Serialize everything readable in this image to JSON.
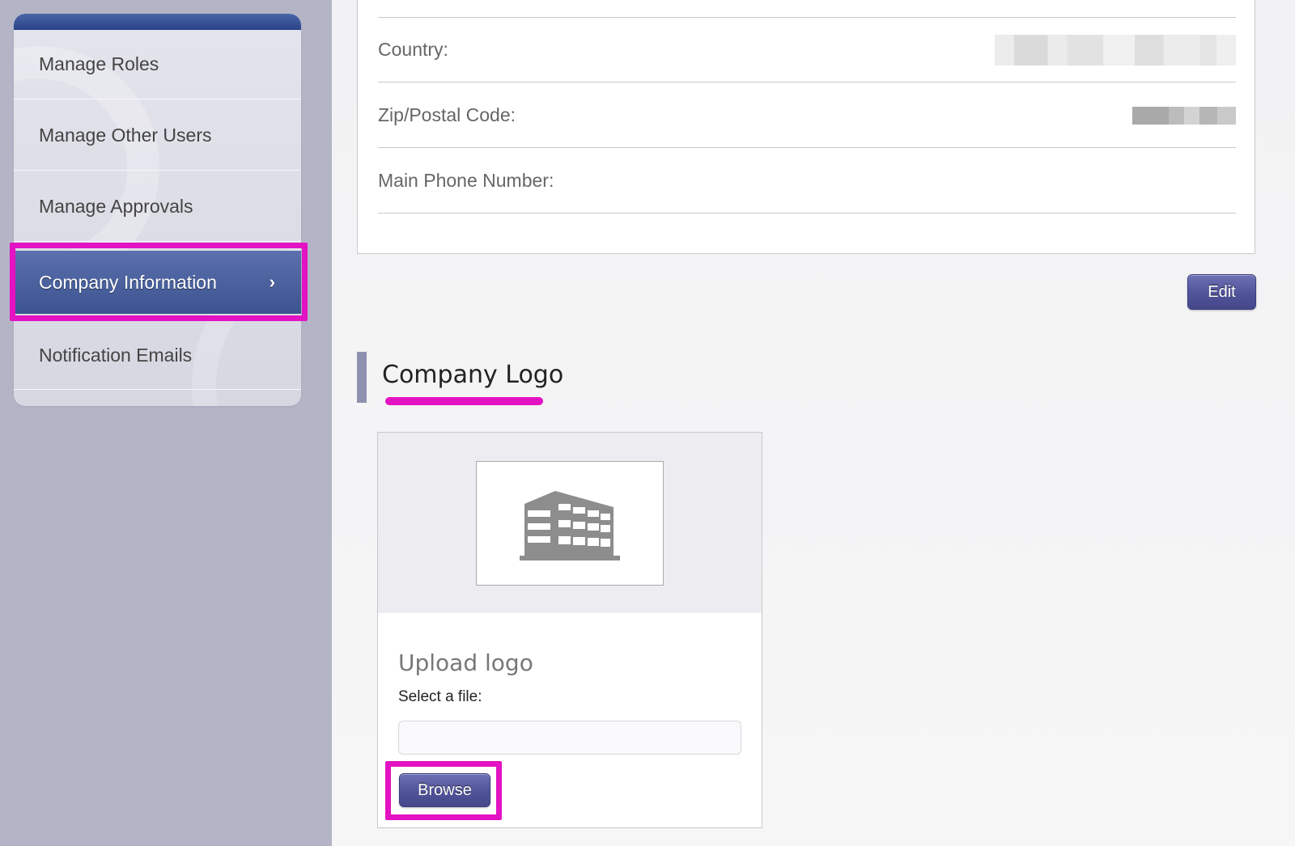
{
  "sidebar": {
    "items": [
      {
        "label": "Manage Roles"
      },
      {
        "label": "Manage Other Users"
      },
      {
        "label": "Manage Approvals"
      },
      {
        "label": "Company Information",
        "active": true
      },
      {
        "label": "Notification Emails"
      }
    ],
    "active_chevron": "›"
  },
  "company_info": {
    "rows": [
      {
        "label": "Country:",
        "value_redacted": true
      },
      {
        "label": "Zip/Postal Code:",
        "value_redacted": true
      },
      {
        "label": "Main Phone Number:",
        "value_redacted": false
      }
    ],
    "edit_label": "Edit"
  },
  "company_logo": {
    "section_title": "Company Logo",
    "placeholder_icon": "building-icon",
    "upload_title": "Upload logo",
    "select_label": "Select a file:",
    "file_value": "",
    "browse_label": "Browse"
  },
  "colors": {
    "accent_highlight": "#e312c3",
    "button": "#505398",
    "sidebar_active": "#4a5f9e",
    "sidebar_bg": "#b3b4c6"
  }
}
